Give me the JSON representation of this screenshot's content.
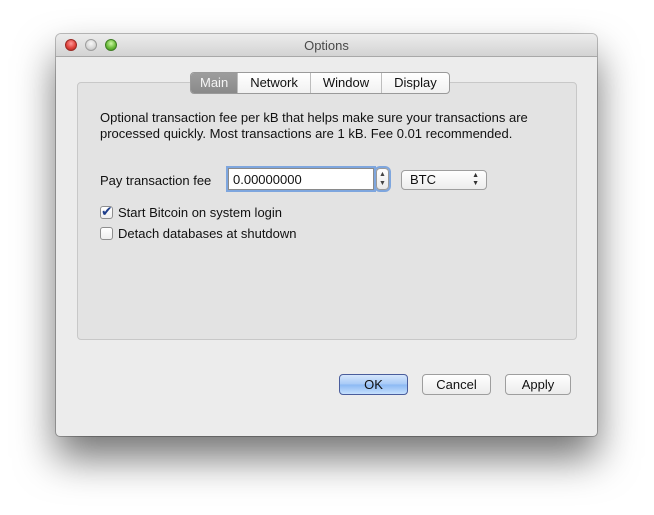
{
  "window": {
    "title": "Options",
    "controls": [
      "close",
      "minimize",
      "zoom"
    ]
  },
  "tabs": [
    {
      "label": "Main",
      "active": true
    },
    {
      "label": "Network",
      "active": false
    },
    {
      "label": "Window",
      "active": false
    },
    {
      "label": "Display",
      "active": false
    }
  ],
  "main": {
    "description": "Optional transaction fee per kB that helps make sure your transactions are processed quickly. Most transactions are 1 kB. Fee 0.01 recommended.",
    "fee_label": "Pay transaction fee",
    "fee_value": "0.00000000",
    "unit_selected": "BTC",
    "checkboxes": [
      {
        "label": "Start Bitcoin on system login",
        "checked": true
      },
      {
        "label": "Detach databases at shutdown",
        "checked": false
      }
    ]
  },
  "buttons": {
    "ok": "OK",
    "cancel": "Cancel",
    "apply": "Apply"
  },
  "icons": {
    "stepper_up": "▲",
    "stepper_down": "▼",
    "select_up": "▲",
    "select_down": "▼"
  }
}
